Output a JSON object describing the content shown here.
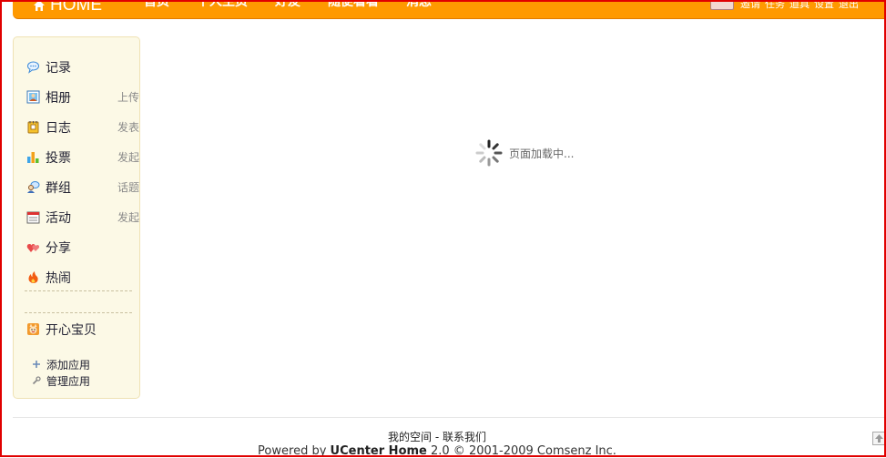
{
  "header": {
    "logo_text": "HOME",
    "nav": [
      "首页",
      "个人主页",
      "好友",
      "随便看看",
      "消息"
    ],
    "user_links": [
      "邀请",
      "任务",
      "道具",
      "设置",
      "退出"
    ]
  },
  "sidebar": {
    "items": [
      {
        "label": "记录",
        "action": "",
        "icon": "speech-bubble-icon"
      },
      {
        "label": "相册",
        "action": "上传",
        "icon": "photo-album-icon"
      },
      {
        "label": "日志",
        "action": "发表",
        "icon": "notebook-icon"
      },
      {
        "label": "投票",
        "action": "发起",
        "icon": "bar-chart-icon"
      },
      {
        "label": "群组",
        "action": "话题",
        "icon": "group-icon"
      },
      {
        "label": "活动",
        "action": "发起",
        "icon": "calendar-icon"
      },
      {
        "label": "分享",
        "action": "",
        "icon": "heart-share-icon"
      },
      {
        "label": "热闹",
        "action": "",
        "icon": "fire-icon"
      }
    ],
    "app_item": {
      "label": "开心宝贝",
      "icon": "happy-baby-icon"
    },
    "add_app": "添加应用",
    "manage_app": "管理应用"
  },
  "main": {
    "loading_text": "页面加载中..."
  },
  "footer": {
    "link_my_space": "我的空间",
    "link_separator": "-",
    "link_contact": "联系我们",
    "powered_prefix": "Powered by",
    "powered_product": "UCenter Home",
    "powered_suffix": "2.0 © 2001-2009 Comsenz Inc."
  },
  "colors": {
    "header_orange": "#ff9900",
    "sidebar_bg": "#fcf9e6",
    "frame_red": "#e00000"
  }
}
